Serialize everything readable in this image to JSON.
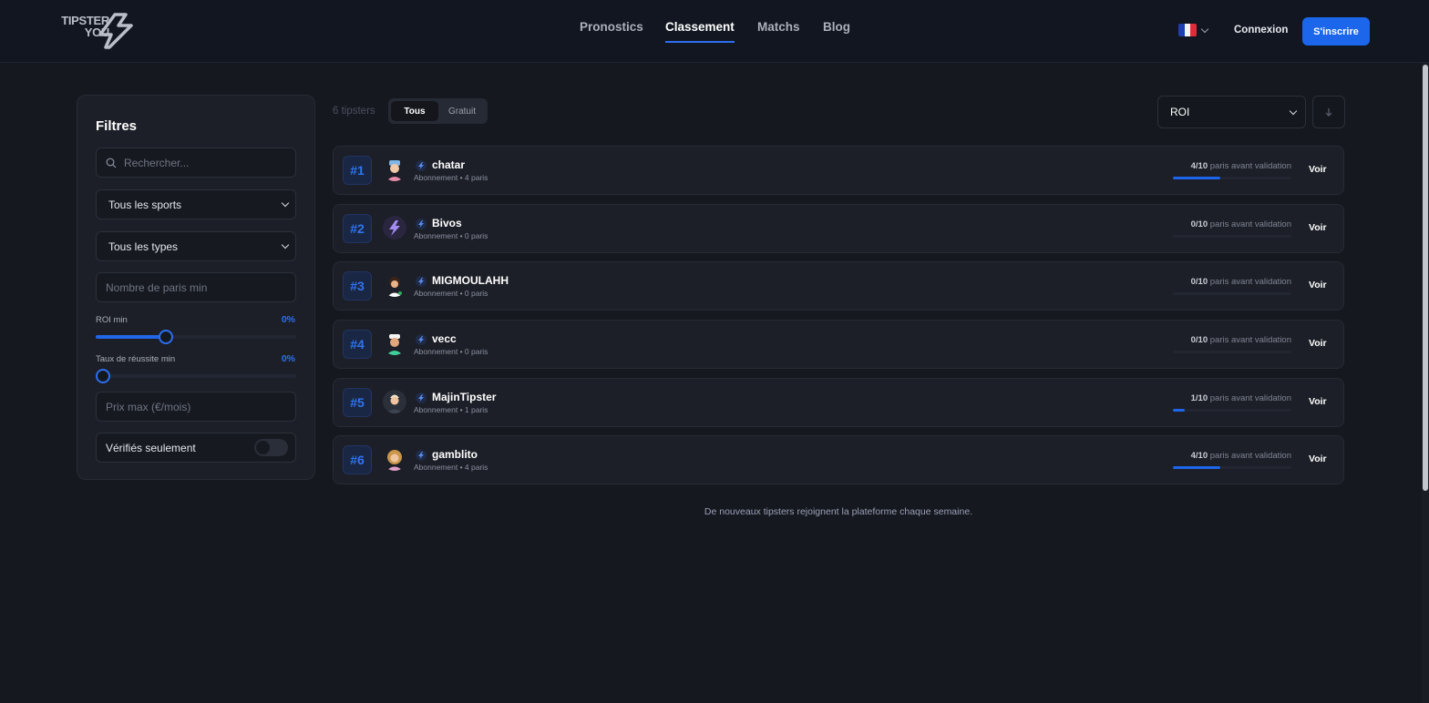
{
  "header": {
    "logo_line1": "TIPSTER",
    "logo_line2": "YOU",
    "nav": [
      {
        "label": "Pronostics",
        "active": false
      },
      {
        "label": "Classement",
        "active": true
      },
      {
        "label": "Matchs",
        "active": false
      },
      {
        "label": "Blog",
        "active": false
      }
    ],
    "login_label": "Connexion",
    "signup_label": "S'inscrire",
    "lang_icon": "flag-fr-icon"
  },
  "filters": {
    "title": "Filtres",
    "search_placeholder": "Rechercher...",
    "sport_select": "Tous les sports",
    "type_select": "Tous les types",
    "min_bets_placeholder": "Nombre de paris min",
    "roi_label": "ROI min",
    "roi_value": "0%",
    "roi_slider_fraction": 0.35,
    "success_label": "Taux de réussite min",
    "success_value": "0%",
    "success_slider_fraction": 0.0,
    "price_placeholder": "Prix max (€/mois)",
    "verified_label": "Vérifiés seulement",
    "verified_on": false
  },
  "list": {
    "count_label": "6 tipsters",
    "segment_all": "Tous",
    "segment_free": "Gratuit",
    "sort_value": "ROI",
    "sort_dir_icon": "arrow-down-icon",
    "tipsters": [
      {
        "rank": "#1",
        "name": "chatar",
        "sub": "Abonnement • 4 paris",
        "progress": "4/10",
        "progress_text": "paris avant validation",
        "fraction": 0.4,
        "voir": "Voir",
        "avatar": "avatar-chatar"
      },
      {
        "rank": "#2",
        "name": "Bivos",
        "sub": "Abonnement • 0 paris",
        "progress": "0/10",
        "progress_text": "paris avant validation",
        "fraction": 0.0,
        "voir": "Voir",
        "avatar": "avatar-bivos"
      },
      {
        "rank": "#3",
        "name": "MIGMOULAHH",
        "sub": "Abonnement • 0 paris",
        "progress": "0/10",
        "progress_text": "paris avant validation",
        "fraction": 0.0,
        "voir": "Voir",
        "avatar": "avatar-migmoulahh"
      },
      {
        "rank": "#4",
        "name": "vecc",
        "sub": "Abonnement • 0 paris",
        "progress": "0/10",
        "progress_text": "paris avant validation",
        "fraction": 0.0,
        "voir": "Voir",
        "avatar": "avatar-vecc"
      },
      {
        "rank": "#5",
        "name": "MajinTipster",
        "sub": "Abonnement • 1 paris",
        "progress": "1/10",
        "progress_text": "paris avant validation",
        "fraction": 0.1,
        "voir": "Voir",
        "avatar": "avatar-majintipster"
      },
      {
        "rank": "#6",
        "name": "gamblito",
        "sub": "Abonnement • 4 paris",
        "progress": "4/10",
        "progress_text": "paris avant validation",
        "fraction": 0.4,
        "voir": "Voir",
        "avatar": "avatar-gamblito"
      }
    ],
    "footer_note": "De nouveaux tipsters rejoignent la plateforme chaque semaine."
  },
  "colors": {
    "accent": "#1b66ea",
    "background": "#16181f",
    "card": "#1c1f27"
  }
}
